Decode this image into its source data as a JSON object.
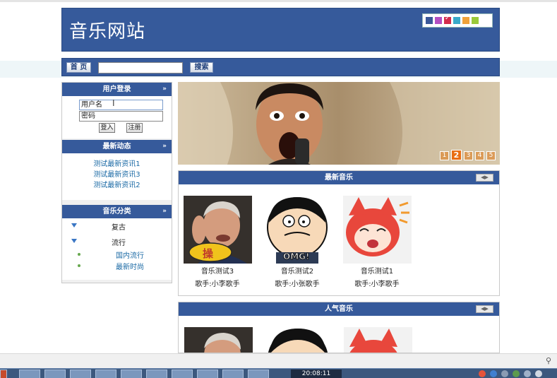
{
  "header": {
    "site_title": "音乐网站",
    "theme_colors": [
      "#3b5898",
      "#b44fc2",
      "#d22c4c",
      "#39a9c9",
      "#f0a23a",
      "#9ac93a"
    ]
  },
  "nav": {
    "home_label": "首 页",
    "search_value": "",
    "search_label": "搜索"
  },
  "sidebar": {
    "login": {
      "title": "用户登录",
      "username_value": "用户名",
      "password_value": "密码",
      "login_label": "登入",
      "register_label": "注册"
    },
    "news": {
      "title": "最新动态",
      "items": [
        "测试最新资讯1",
        "测试最新资讯3",
        "测试最新资讯2"
      ]
    },
    "categories": {
      "title": "音乐分类",
      "items": [
        {
          "label": "复古",
          "children": []
        },
        {
          "label": "流行",
          "children": [
            "国内流行",
            "最新时尚"
          ]
        }
      ]
    }
  },
  "banner": {
    "pages": [
      "1",
      "2",
      "3",
      "4",
      "5"
    ],
    "active_page": "2"
  },
  "latest_music": {
    "title": "最新音乐",
    "items": [
      {
        "title": "音乐测试3",
        "artist": "歌手:小李歌手",
        "badge": "操"
      },
      {
        "title": "音乐测试2",
        "artist": "歌手:小张歌手",
        "badge": "OMG!"
      },
      {
        "title": "音乐测试1",
        "artist": "歌手:小李歌手",
        "badge": ""
      }
    ]
  },
  "popular_music": {
    "title": "人气音乐"
  },
  "taskbar": {
    "clock": "20:08:11"
  }
}
